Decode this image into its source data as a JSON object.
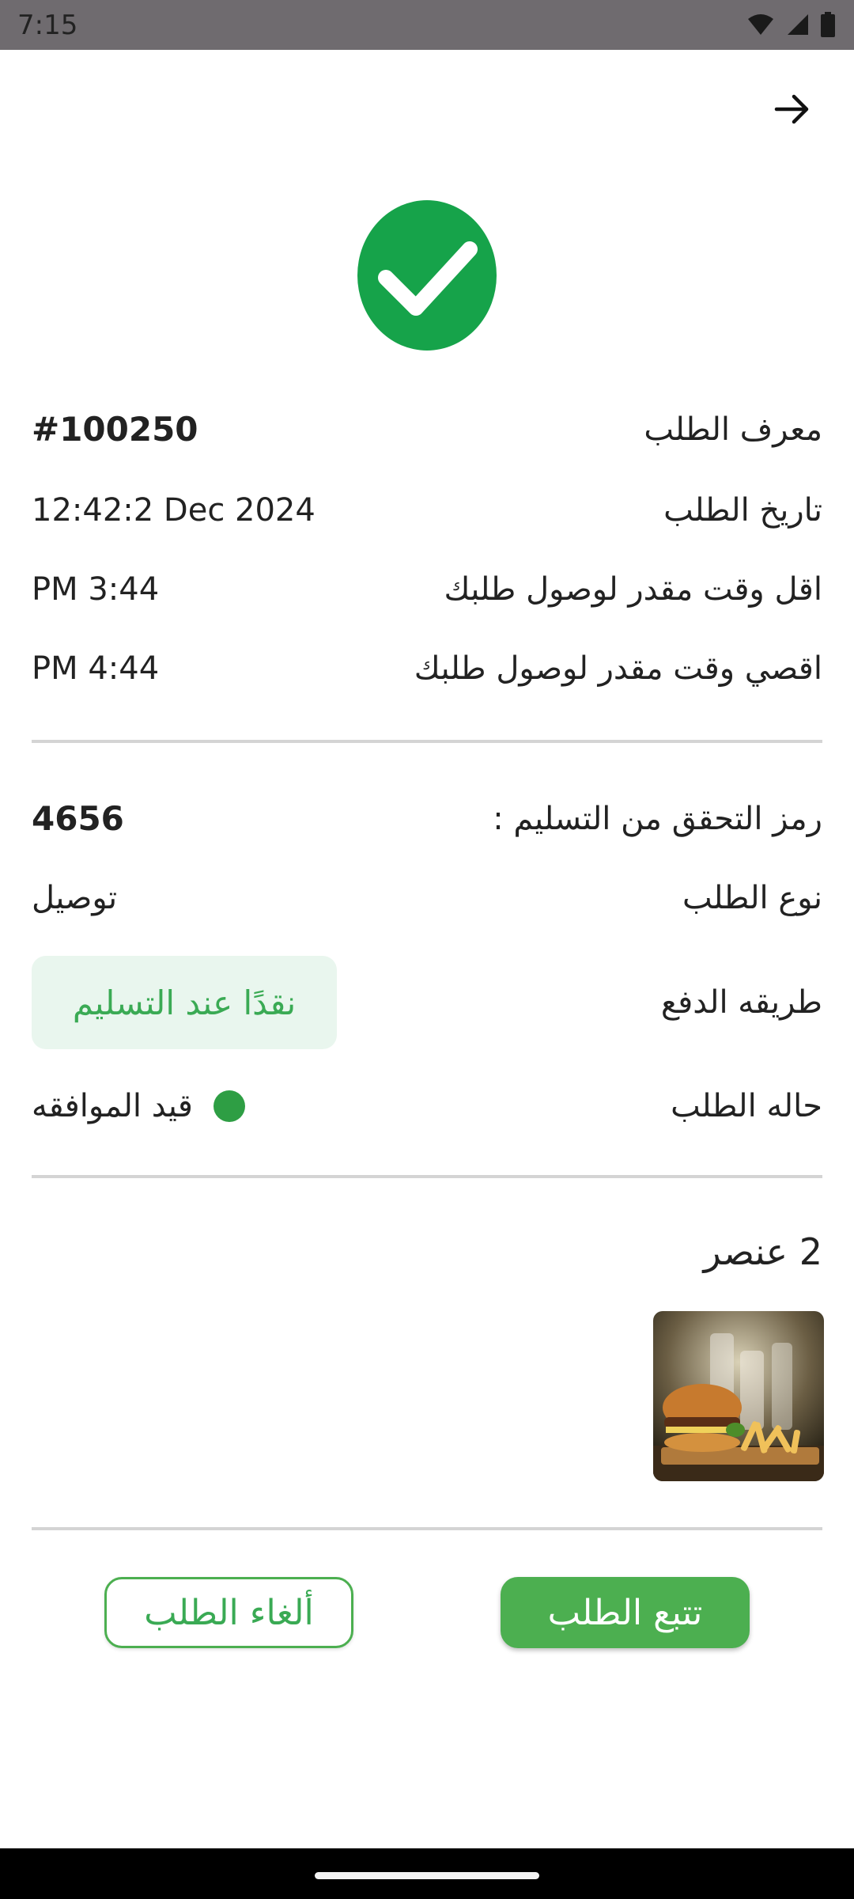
{
  "status_bar": {
    "time": "7:15"
  },
  "order": {
    "id_label": "معرف الطلب",
    "id_value": "#100250",
    "date_label": "تاريخ الطلب",
    "date_value": "12:42:2   Dec 2024",
    "min_time_label": "اقل وقت مقدر لوصول طلبك",
    "min_time_value": "PM 3:44",
    "max_time_label": "اقصي وقت مقدر لوصول طلبك",
    "max_time_value": "PM 4:44"
  },
  "delivery": {
    "code_label": "رمز التحقق من التسليم :",
    "code_value": "4656",
    "type_label": "نوع الطلب",
    "type_value": "توصيل",
    "payment_label": "طريقه الدفع",
    "payment_value": "نقدًا عند التسليم",
    "status_label": "حاله الطلب",
    "status_value": "قيد الموافقه"
  },
  "items": {
    "count_label": "2 عنصر"
  },
  "actions": {
    "track": "تتبع الطلب",
    "cancel": "ألغاء الطلب"
  },
  "colors": {
    "accent": "#4caf50",
    "success": "#16a34a",
    "status_dot": "#2e9e44"
  }
}
